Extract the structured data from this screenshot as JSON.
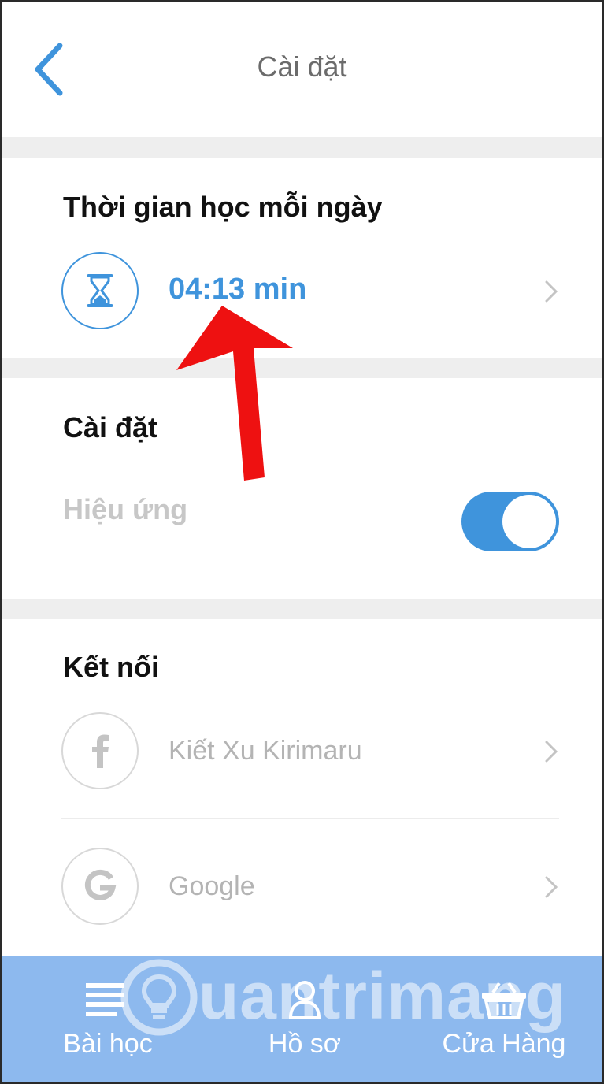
{
  "header": {
    "title": "Cài đặt",
    "back_icon": "chevron-left-icon"
  },
  "daily_time": {
    "section_title": "Thời gian học mỗi ngày",
    "value": "04:13 min",
    "icon": "hourglass-icon"
  },
  "settings": {
    "section_title": "Cài đặt",
    "effect_label": "Hiệu ứng",
    "effect_enabled": true
  },
  "connect": {
    "section_title": "Kết nối",
    "items": [
      {
        "label": "Kiết Xu Kirimaru",
        "icon": "facebook-icon"
      },
      {
        "label": "Google",
        "icon": "google-icon"
      }
    ]
  },
  "tabs": [
    {
      "label": "Bài học",
      "icon": "lessons-icon"
    },
    {
      "label": "Hồ sơ",
      "icon": "profile-icon"
    },
    {
      "label": "Cửa Hàng",
      "icon": "shop-basket-icon"
    }
  ],
  "watermark": {
    "text": "uantrimang"
  },
  "colors": {
    "accent": "#3f94dc",
    "tabbar": "#8db9ee",
    "arrow": "#ee1111"
  }
}
